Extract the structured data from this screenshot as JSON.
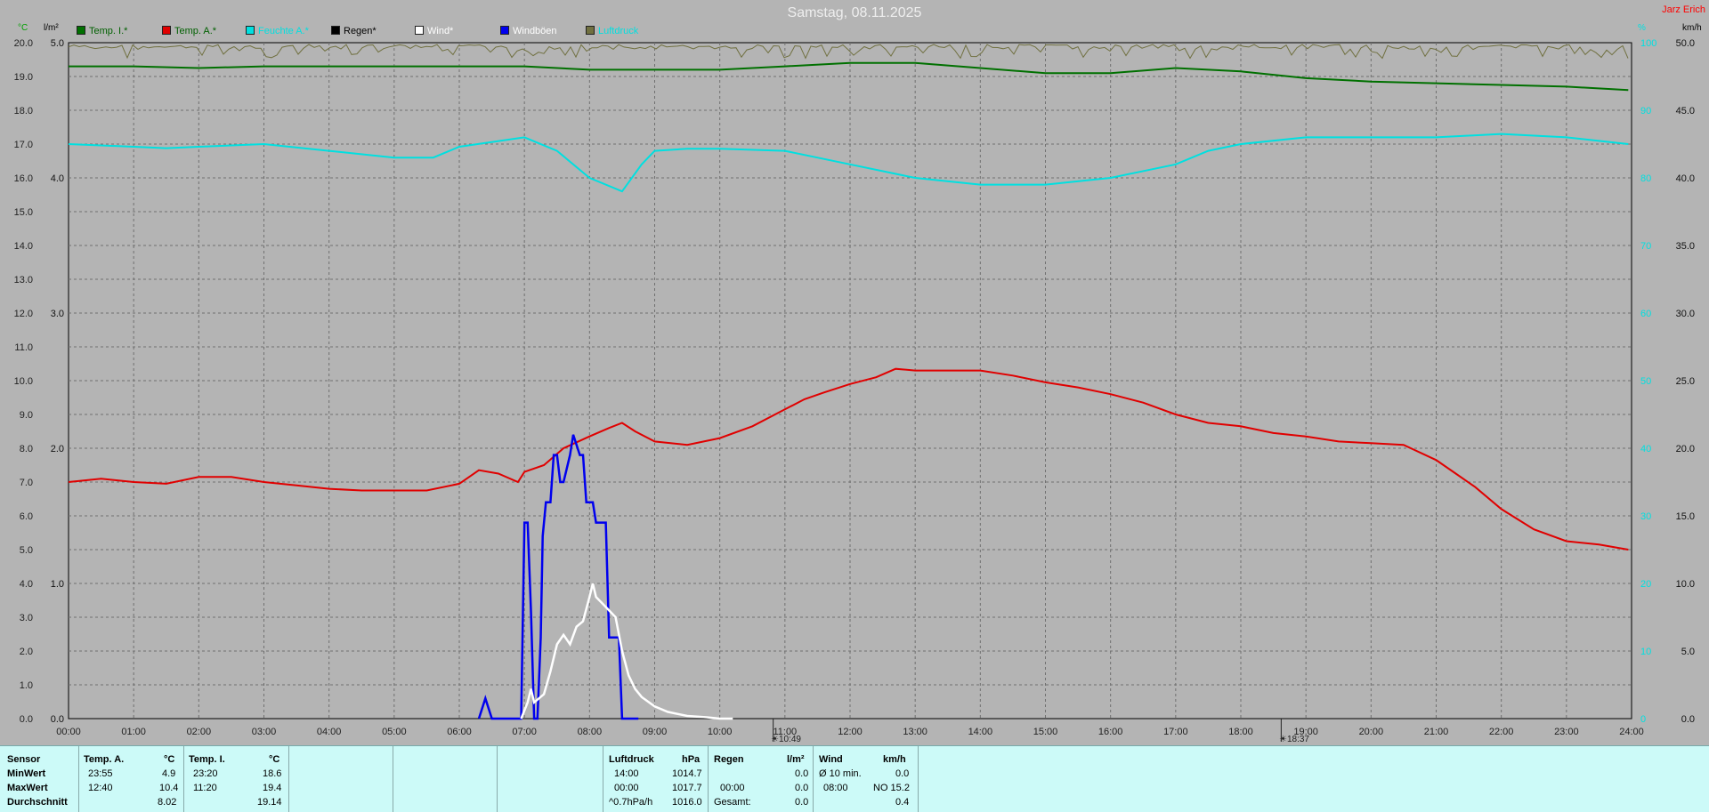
{
  "title": "Samstag, 08.11.2025",
  "author": "Jarz Erich",
  "units": {
    "left_temp": "°C",
    "left_rain": "l/m²",
    "right_pct": "%",
    "right_wind": "km/h"
  },
  "legend": [
    {
      "label": "Temp. I.*",
      "color": "#007000",
      "text_color": "#006000"
    },
    {
      "label": "Temp. A.*",
      "color": "#e00000",
      "text_color": "#006000"
    },
    {
      "label": "Feuchte A.*",
      "color": "#00e0e0",
      "text_color": "#00e0e0"
    },
    {
      "label": "Regen*",
      "color": "#000000",
      "text_color": "#000000"
    },
    {
      "label": "Wind*",
      "color": "#ffffff",
      "text_color": "#ffffff"
    },
    {
      "label": "Windböen",
      "color": "#0000ee",
      "text_color": "#ffffff"
    },
    {
      "label": "Luftdruck",
      "color": "#707040",
      "text_color": "#00e0e0"
    }
  ],
  "markers": [
    {
      "icon": "sunrise-icon",
      "label": "10:49",
      "hour": 10.82
    },
    {
      "icon": "sunset-icon",
      "label": "18:37",
      "hour": 18.62
    }
  ],
  "chart_data": {
    "type": "line",
    "x_unit": "hour",
    "x_ticks": [
      "00:00",
      "01:00",
      "02:00",
      "03:00",
      "04:00",
      "05:00",
      "06:00",
      "07:00",
      "08:00",
      "09:00",
      "10:00",
      "11:00",
      "12:00",
      "13:00",
      "14:00",
      "15:00",
      "16:00",
      "17:00",
      "18:00",
      "19:00",
      "20:00",
      "21:00",
      "22:00",
      "23:00",
      "24:00"
    ],
    "xlim": [
      0,
      24
    ],
    "y_temp": {
      "range": [
        0,
        20
      ],
      "ticks": [
        "0.0",
        "1.0",
        "2.0",
        "3.0",
        "4.0",
        "5.0",
        "6.0",
        "7.0",
        "8.0",
        "9.0",
        "10.0",
        "11.0",
        "12.0",
        "13.0",
        "14.0",
        "15.0",
        "16.0",
        "17.0",
        "18.0",
        "19.0",
        "20.0"
      ]
    },
    "y_rain": {
      "range": [
        0,
        5
      ],
      "ticks": [
        "0.0",
        "1.0",
        "2.0",
        "3.0",
        "4.0",
        "5.0"
      ]
    },
    "y_pct": {
      "range": [
        0,
        100
      ],
      "ticks": [
        "0",
        "10",
        "20",
        "30",
        "40",
        "50",
        "60",
        "70",
        "80",
        "90",
        "100"
      ]
    },
    "y_wind": {
      "range": [
        0,
        50
      ],
      "ticks": [
        "0.0",
        "5.0",
        "10.0",
        "15.0",
        "20.0",
        "25.0",
        "30.0",
        "35.0",
        "40.0",
        "45.0",
        "50.0"
      ]
    },
    "grid": true,
    "series": [
      {
        "name": "Temp. I.*",
        "axis": "temp",
        "color": "#007000",
        "x": [
          0,
          1,
          2,
          3,
          4,
          5,
          6,
          7,
          8,
          9,
          10,
          11,
          12,
          13,
          14,
          15,
          16,
          17,
          18,
          19,
          20,
          21,
          22,
          23,
          23.95
        ],
        "y": [
          19.3,
          19.3,
          19.25,
          19.3,
          19.3,
          19.3,
          19.3,
          19.3,
          19.2,
          19.2,
          19.2,
          19.3,
          19.4,
          19.4,
          19.25,
          19.1,
          19.1,
          19.25,
          19.15,
          18.95,
          18.85,
          18.8,
          18.75,
          18.7,
          18.6
        ]
      },
      {
        "name": "Temp. A.*",
        "axis": "temp",
        "color": "#e00000",
        "x": [
          0,
          0.5,
          1,
          1.5,
          2,
          2.5,
          3,
          3.5,
          4,
          4.5,
          5,
          5.5,
          6,
          6.3,
          6.6,
          6.9,
          7,
          7.3,
          7.6,
          8,
          8.3,
          8.5,
          8.7,
          9,
          9.5,
          10,
          10.5,
          11,
          11.3,
          11.6,
          12,
          12.4,
          12.7,
          13,
          13.5,
          14,
          14.5,
          15,
          15.5,
          16,
          16.5,
          17,
          17.5,
          18,
          18.5,
          19,
          19.5,
          20,
          20.5,
          21,
          21.3,
          21.6,
          22,
          22.5,
          23,
          23.5,
          23.95
        ],
        "y": [
          7.0,
          7.1,
          7.0,
          6.95,
          7.15,
          7.15,
          7.0,
          6.9,
          6.8,
          6.75,
          6.75,
          6.75,
          6.95,
          7.35,
          7.25,
          7.0,
          7.3,
          7.5,
          8.0,
          8.35,
          8.6,
          8.75,
          8.5,
          8.2,
          8.1,
          8.3,
          8.65,
          9.15,
          9.45,
          9.65,
          9.9,
          10.1,
          10.35,
          10.3,
          10.3,
          10.3,
          10.15,
          9.95,
          9.8,
          9.6,
          9.35,
          9.0,
          8.75,
          8.65,
          8.45,
          8.35,
          8.2,
          8.15,
          8.1,
          7.65,
          7.25,
          6.85,
          6.2,
          5.6,
          5.25,
          5.15,
          5.0
        ]
      },
      {
        "name": "Feuchte A.*",
        "axis": "pct",
        "color": "#00e0e0",
        "x": [
          0,
          1,
          1.5,
          2,
          3,
          4,
          5,
          5.6,
          6,
          7,
          7.5,
          8,
          8.5,
          8.8,
          9,
          9.5,
          10,
          11,
          12,
          13,
          14,
          15,
          16,
          17,
          17.5,
          18,
          19,
          20,
          21,
          22,
          23,
          23.95
        ],
        "y": [
          85,
          84.6,
          84.4,
          84.6,
          85,
          84,
          83,
          83,
          84.6,
          86,
          84,
          80,
          78,
          82,
          84,
          84.3,
          84.3,
          84,
          82,
          80,
          79,
          79,
          80,
          82,
          84,
          85,
          86,
          86,
          86,
          86.5,
          86,
          85
        ]
      },
      {
        "name": "Windböen",
        "axis": "wind",
        "color": "#0000ee",
        "x": [
          6.3,
          6.4,
          6.5,
          6.95,
          7.0,
          7.05,
          7.1,
          7.15,
          7.2,
          7.25,
          7.28,
          7.33,
          7.4,
          7.45,
          7.5,
          7.55,
          7.6,
          7.7,
          7.75,
          7.85,
          7.9,
          7.95,
          8.0,
          8.05,
          8.1,
          8.2,
          8.25,
          8.3,
          8.35,
          8.4,
          8.45,
          8.5,
          8.55,
          8.6,
          8.65,
          8.7,
          8.75
        ],
        "y": [
          0,
          1.5,
          0,
          0,
          14.5,
          14.5,
          8,
          0,
          0,
          6,
          13.5,
          16,
          16,
          19.5,
          19.5,
          17.5,
          17.5,
          19.5,
          21,
          19.5,
          19.5,
          16,
          16,
          16,
          14.5,
          14.5,
          14.5,
          6,
          6,
          6,
          6,
          0,
          0,
          0,
          0,
          0,
          0
        ]
      },
      {
        "name": "Wind*",
        "axis": "wind",
        "color": "#ffffff",
        "x": [
          6.95,
          7.05,
          7.1,
          7.15,
          7.3,
          7.4,
          7.5,
          7.6,
          7.7,
          7.8,
          7.9,
          8.0,
          8.05,
          8.1,
          8.2,
          8.3,
          8.4,
          8.5,
          8.6,
          8.7,
          8.8,
          9.0,
          9.2,
          9.5,
          9.8,
          10.0,
          10.2
        ],
        "y": [
          0,
          1.2,
          2.2,
          1.2,
          1.8,
          3.5,
          5.5,
          6.2,
          5.5,
          6.8,
          7.2,
          9.0,
          10.0,
          9.0,
          8.5,
          8.0,
          7.5,
          5.0,
          3.2,
          2.2,
          1.6,
          0.9,
          0.5,
          0.2,
          0.1,
          0.0,
          0.0
        ]
      },
      {
        "name": "Luftdruck",
        "axis": "pct",
        "color": "#707040",
        "x": [
          0,
          24
        ],
        "y": [
          100,
          100
        ]
      }
    ]
  },
  "table": {
    "sensor_header": "Sensor",
    "rows": [
      "MinWert",
      "MaxWert",
      "Durchschnitt"
    ],
    "temp_a": {
      "header": "Temp. A.",
      "unit": "°C",
      "min_time": "23:55",
      "min_val": "4.9",
      "max_time": "12:40",
      "max_val": "10.4",
      "avg": "8.02"
    },
    "temp_i": {
      "header": "Temp. I.",
      "unit": "°C",
      "min_time": "23:20",
      "min_val": "18.6",
      "max_time": "11:20",
      "max_val": "19.4",
      "avg": "19.14"
    },
    "pressure": {
      "header": "Luftdruck",
      "unit": "hPa",
      "min_time": "14:00",
      "min_val": "1014.7",
      "max_time": "00:00",
      "max_val": "1017.7",
      "trend": "^0.7hPa/h",
      "avg": "1016.0"
    },
    "rain": {
      "header": "Regen",
      "unit": "l/m²",
      "time": "00:00",
      "val": "0.0",
      "r1": "0.0",
      "total_label": "Gesamt:",
      "total": "0.0"
    },
    "wind": {
      "header": "Wind",
      "unit": "km/h",
      "avg_label": "Ø 10 min.",
      "avg_val": "0.0",
      "max_time": "08:00",
      "max_val": "NO 15.2",
      "avg": "0.4"
    }
  }
}
